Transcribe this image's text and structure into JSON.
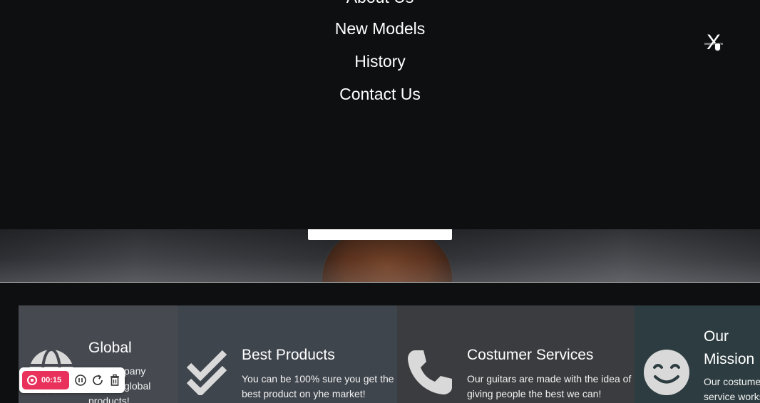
{
  "nav": {
    "items": [
      {
        "label": "About Us"
      },
      {
        "label": "New Models"
      },
      {
        "label": "History"
      },
      {
        "label": "Contact Us"
      }
    ],
    "close_label": "X"
  },
  "features": [
    {
      "title": "Global",
      "text_lines": [
        "pany",
        "global",
        "products!"
      ],
      "icon": "globe-icon"
    },
    {
      "title": "Best Products",
      "text_lines": [
        "You can be 100% sure you get the",
        "best product on yhe market!"
      ],
      "icon": "double-check-icon"
    },
    {
      "title": "Costumer Services",
      "text_lines": [
        "Our guitars are made with the idea of",
        "giving people the best we can!"
      ],
      "icon": "phone-icon"
    },
    {
      "title_lines": [
        "Our",
        "Mission"
      ],
      "text_lines": [
        "Our costumer",
        "service works"
      ],
      "icon": "smiley-icon"
    }
  ],
  "recorder": {
    "time": "00:15",
    "buttons": [
      "pause-icon",
      "restart-icon",
      "trash-icon"
    ]
  },
  "colors": {
    "overlay_bg": "#0e0f10",
    "record_red": "#e8315b",
    "card_global": "#464a50",
    "card_best": "#3f454d",
    "card_service": "#3b3c3f",
    "card_mission": "#2c3c40"
  }
}
